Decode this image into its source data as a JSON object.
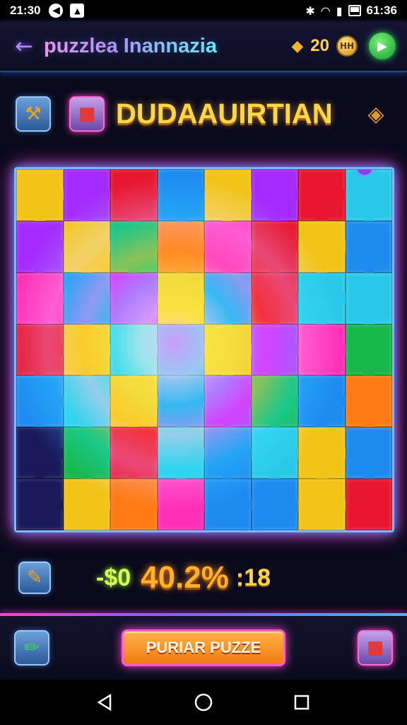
{
  "status_bar": {
    "time": "21:30",
    "clock": "61:36",
    "left_icons": [
      "notification-circle-icon",
      "notification-square-icon"
    ],
    "right_icons": [
      "vibrate-icon",
      "wifi-icon",
      "signal-icon",
      "battery-icon"
    ]
  },
  "header": {
    "title": "puzzlea Inannazia",
    "coins": "20",
    "coin_badge": "HH",
    "icons": [
      "back-arrow-icon",
      "key-icon",
      "coin-icon",
      "play-icon"
    ]
  },
  "puzzle_header": {
    "name": "DUDAAUIRTIAN",
    "icons": [
      "hammer-icon",
      "paint-icon",
      "ticket-icon"
    ]
  },
  "board": {
    "rows": 7,
    "cols": 8,
    "palette": [
      "#e8162e",
      "#1e8bf0",
      "#16b84a",
      "#f2c418",
      "#a52aff",
      "#ff2fb9",
      "#ff7a12",
      "#2ac8e8"
    ],
    "missing_piece_region": "bottom-left"
  },
  "score": {
    "delta": "-$0",
    "percent": "40.2%",
    "time": ":18",
    "icons": [
      "hint-icon"
    ]
  },
  "action_bar": {
    "main_button": "PURIAR PUZZE",
    "icons": [
      "edit-icon",
      "gift-icon"
    ]
  },
  "nav_bar": {
    "icons": [
      "back-nav-icon",
      "home-nav-icon",
      "recents-nav-icon"
    ]
  },
  "colors": {
    "accent_pink": "#ff47c8",
    "accent_blue": "#3f8cff",
    "gold": "#ffd648",
    "orange": "#f07a10"
  }
}
